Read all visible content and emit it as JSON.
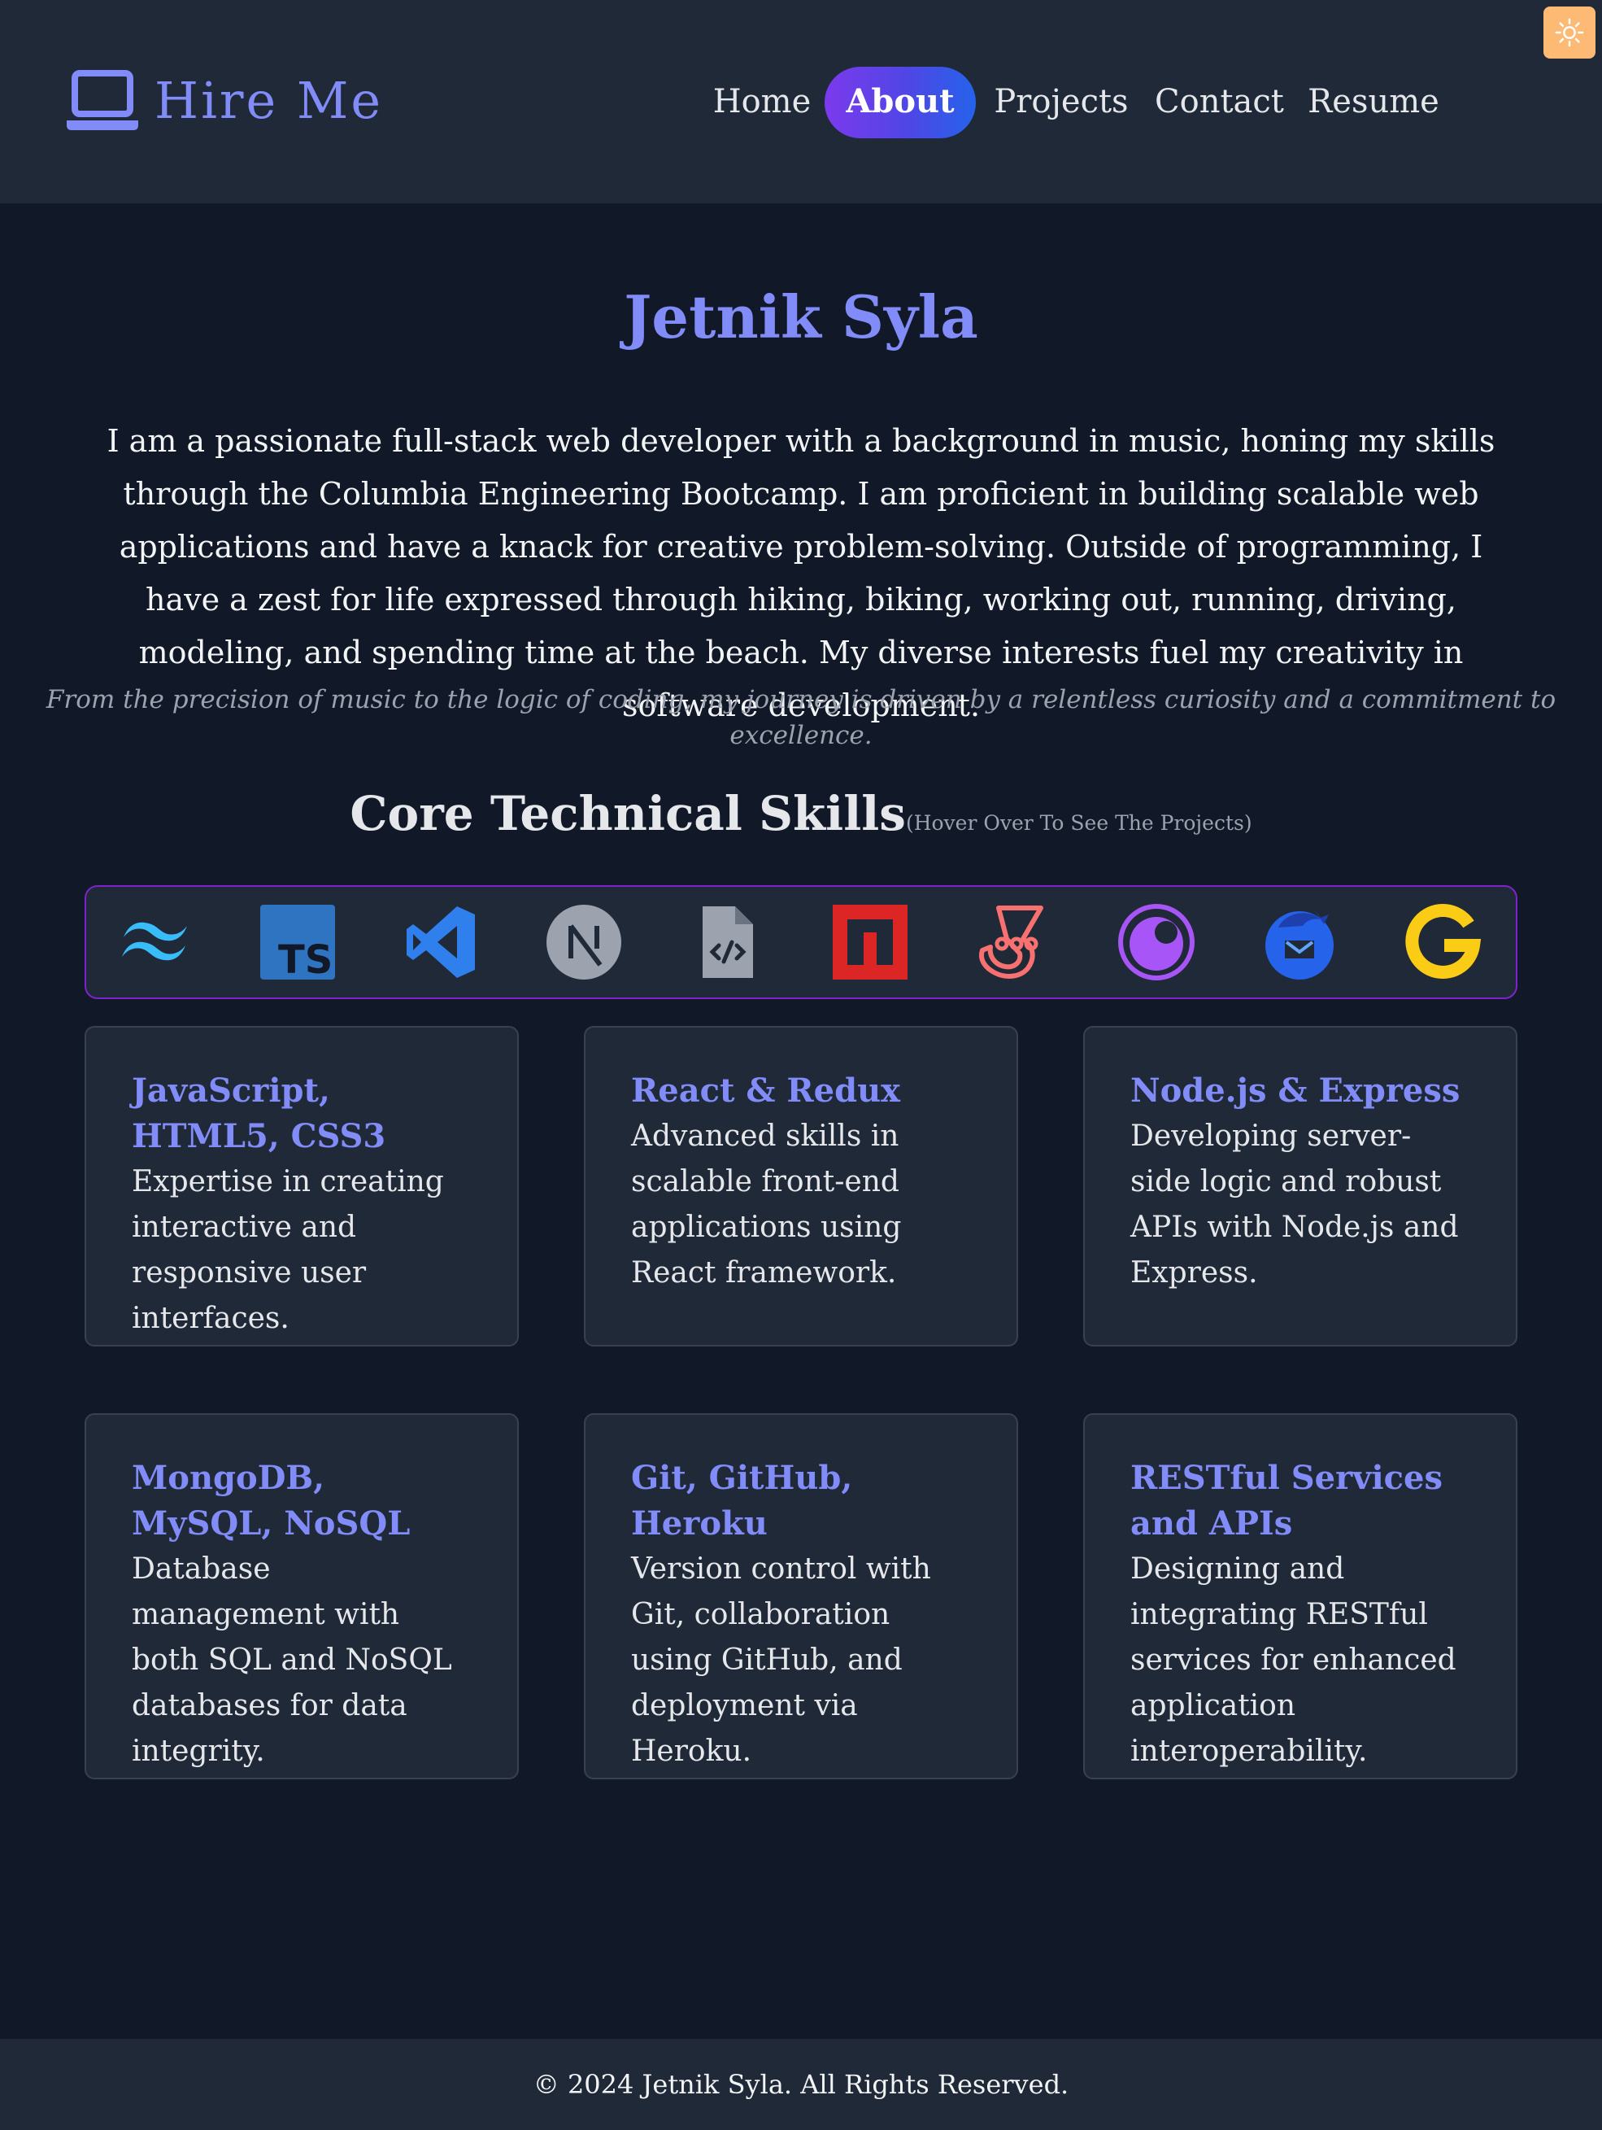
{
  "header": {
    "brand_text": "Hire Me",
    "brand_icon": "laptop-icon",
    "nav": [
      {
        "label": "Home",
        "active": false
      },
      {
        "label": "About",
        "active": true
      },
      {
        "label": "Projects",
        "active": false
      },
      {
        "label": "Contact",
        "active": false
      },
      {
        "label": "Resume",
        "active": false
      }
    ],
    "theme_toggle_icon": "sun-icon"
  },
  "about": {
    "name": "Jetnik Syla",
    "bio": "I am a passionate full-stack web developer with a background in music, honing my skills through the Columbia Engineering Bootcamp. I am proficient in building scalable web applications and have a knack for creative problem-solving. Outside of programming, I have a zest for life expressed through hiking, biking, working out, running, driving, modeling, and spending time at the beach. My diverse interests fuel my creativity in software development.",
    "tagline": "From the precision of music to the logic of coding, my journey is driven by a relentless curiosity and a commitment to excellence."
  },
  "skills": {
    "title": "Core Technical Skills",
    "hint": "(Hover Over To See The Projects)",
    "icons": [
      "tailwindcss-icon",
      "typescript-icon",
      "vscode-icon",
      "nextjs-icon",
      "code-file-icon",
      "npm-icon",
      "jest-icon",
      "insomnia-icon",
      "thunderbird-icon",
      "google-icon"
    ],
    "cards": [
      {
        "title": "JavaScript, HTML5, CSS3",
        "description": "Expertise in creating interactive and responsive user interfaces."
      },
      {
        "title": "React & Redux",
        "description": "Advanced skills in scalable front-end applications using React framework."
      },
      {
        "title": "Node.js & Express",
        "description": "Developing server-side logic and robust APIs with Node.js and Express."
      },
      {
        "title": "MongoDB, MySQL, NoSQL",
        "description": "Database management with both SQL and NoSQL databases for data integrity."
      },
      {
        "title": "Git, GitHub, Heroku",
        "description": "Version control with Git, collaboration using GitHub, and deployment via Heroku."
      },
      {
        "title": "RESTful Services and APIs",
        "description": "Designing and integrating RESTful services for enhanced application interoperability."
      }
    ]
  },
  "footer": {
    "text": "© 2024 Jetnik Syla. All Rights Reserved."
  },
  "colors": {
    "background": "#111827",
    "header": "#1f2937",
    "accent": "#818cf8",
    "nav_active_start": "#7c3aed",
    "nav_active_end": "#2563eb",
    "toggle": "#fdba74",
    "icon_bar_border": "#7e22ce"
  }
}
